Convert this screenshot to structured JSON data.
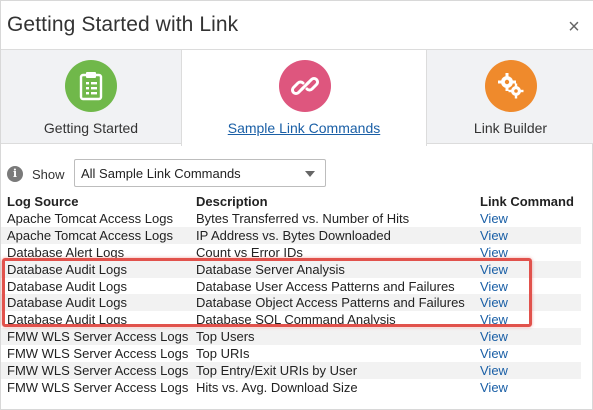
{
  "dialog": {
    "title": "Getting Started with Link",
    "close_icon": "×"
  },
  "tabs": [
    {
      "label": "Getting Started",
      "icon": "clipboard-icon",
      "color": "#70b84a"
    },
    {
      "label": "Sample Link Commands",
      "icon": "link-icon",
      "color": "#de567e"
    },
    {
      "label": "Link Builder",
      "icon": "gears-icon",
      "color": "#ef8a2c"
    }
  ],
  "filter": {
    "info_icon": "i",
    "show_label": "Show",
    "selected": "All Sample Link Commands"
  },
  "table": {
    "headers": [
      "Log Source",
      "Description",
      "Link Command"
    ],
    "rows": [
      {
        "source": "Apache Tomcat Access Logs",
        "description": "Bytes Transferred vs. Number of Hits",
        "command": "View"
      },
      {
        "source": "Apache Tomcat Access Logs",
        "description": "IP Address vs. Bytes Downloaded",
        "command": "View"
      },
      {
        "source": "Database Alert Logs",
        "description": "Count vs Error IDs",
        "command": "View"
      },
      {
        "source": "Database Audit Logs",
        "description": "Database Server Analysis",
        "command": "View"
      },
      {
        "source": "Database Audit Logs",
        "description": "Database User Access Patterns and Failures",
        "command": "View"
      },
      {
        "source": "Database Audit Logs",
        "description": "Database Object Access Patterns and Failures",
        "command": "View"
      },
      {
        "source": "Database Audit Logs",
        "description": "Database SQL Command Analysis",
        "command": "View"
      },
      {
        "source": "FMW WLS Server Access Logs",
        "description": "Top Users",
        "command": "View"
      },
      {
        "source": "FMW WLS Server Access Logs",
        "description": "Top URIs",
        "command": "View"
      },
      {
        "source": "FMW WLS Server Access Logs",
        "description": "Top Entry/Exit URIs by User",
        "command": "View"
      },
      {
        "source": "FMW WLS Server Access Logs",
        "description": "Hits vs. Avg. Download Size",
        "command": "View"
      }
    ]
  },
  "colors": {
    "link": "#1a5fa6",
    "highlight": "#e1524c"
  }
}
